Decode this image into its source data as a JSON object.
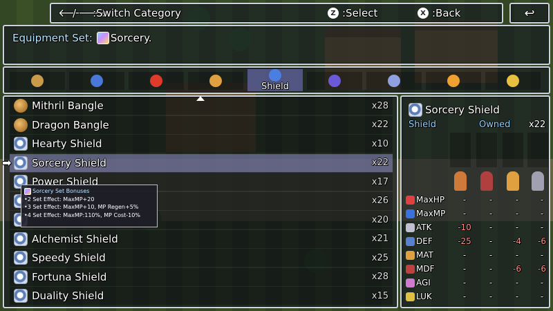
{
  "help_bar": {
    "switch_label": ":Switch Category",
    "select_key": "Z",
    "select_label": ":Select",
    "back_key": "X",
    "back_label": ":Back"
  },
  "description": {
    "prefix": "Equipment Set:",
    "set_name": "Sorcery."
  },
  "categories": [
    {
      "name": "bag",
      "color": "#c89a4a"
    },
    {
      "name": "potion",
      "color": "#4a78d8"
    },
    {
      "name": "orb",
      "color": "#e03a2a"
    },
    {
      "name": "sword",
      "color": "#e0a040"
    },
    {
      "name": "Shield",
      "label": "Shield",
      "color": "#4a7fe0",
      "selected": true
    },
    {
      "name": "helmet",
      "color": "#6a5ad8"
    },
    {
      "name": "armor",
      "color": "#8fa0e0"
    },
    {
      "name": "ring",
      "color": "#f0a030"
    },
    {
      "name": "key",
      "color": "#e8c040"
    }
  ],
  "items": [
    {
      "name": "Mithril Bangle",
      "count": "x28",
      "icon": "bangle"
    },
    {
      "name": "Dragon Bangle",
      "count": "x22",
      "icon": "bangle"
    },
    {
      "name": "Hearty Shield",
      "count": "x10",
      "icon": "shield"
    },
    {
      "name": "Sorcery Shield",
      "count": "x22",
      "icon": "shield",
      "selected": true
    },
    {
      "name": "Power Shield",
      "count": "x17",
      "icon": "shield"
    },
    {
      "name": "",
      "count": "x26",
      "icon": "shield"
    },
    {
      "name": "",
      "count": "x20",
      "icon": "shield"
    },
    {
      "name": "Alchemist Shield",
      "count": "x21",
      "icon": "shield"
    },
    {
      "name": "Speedy Shield",
      "count": "x25",
      "icon": "shield"
    },
    {
      "name": "Fortuna Shield",
      "count": "x28",
      "icon": "shield"
    },
    {
      "name": "Duality Shield",
      "count": "x15",
      "icon": "shield"
    }
  ],
  "tooltip": {
    "title": "Sorcery Set Bonuses",
    "lines": [
      "•2 Set Effect: MaxMP+20",
      "•3 Set Effect: MaxMP+10, MP Regen+5%",
      "•4 Set Effect: MaxMP:110%, MP Cost-10%"
    ]
  },
  "status": {
    "item_name": "Sorcery Shield",
    "type_label": "Shield",
    "owned_label": "Owned",
    "owned_count": "x22",
    "actor_colors": [
      "#d07a3a",
      "#b04040",
      "#e0a040",
      "#a0a0b0"
    ],
    "stats": [
      {
        "name": "MaxHP",
        "icon_color": "#e04040",
        "values": [
          "-",
          "-",
          "-",
          "-"
        ]
      },
      {
        "name": "MaxMP",
        "icon_color": "#3a70e0",
        "values": [
          "-",
          "-",
          "-",
          "-"
        ]
      },
      {
        "name": "ATK",
        "icon_color": "#c0c0d0",
        "values": [
          "-10",
          "-",
          "-",
          "-"
        ]
      },
      {
        "name": "DEF",
        "icon_color": "#5a80d0",
        "values": [
          "-25",
          "-",
          "-4",
          "-6"
        ]
      },
      {
        "name": "MAT",
        "icon_color": "#e0a040",
        "values": [
          "-",
          "-",
          "-",
          "-"
        ]
      },
      {
        "name": "MDF",
        "icon_color": "#c04040",
        "values": [
          "-",
          "-",
          "-6",
          "-6"
        ]
      },
      {
        "name": "AGI",
        "icon_color": "#d07ad0",
        "values": [
          "-",
          "-",
          "-",
          "-"
        ]
      },
      {
        "name": "LUK",
        "icon_color": "#e0c040",
        "values": [
          "-",
          "-",
          "-",
          "-"
        ]
      }
    ]
  }
}
